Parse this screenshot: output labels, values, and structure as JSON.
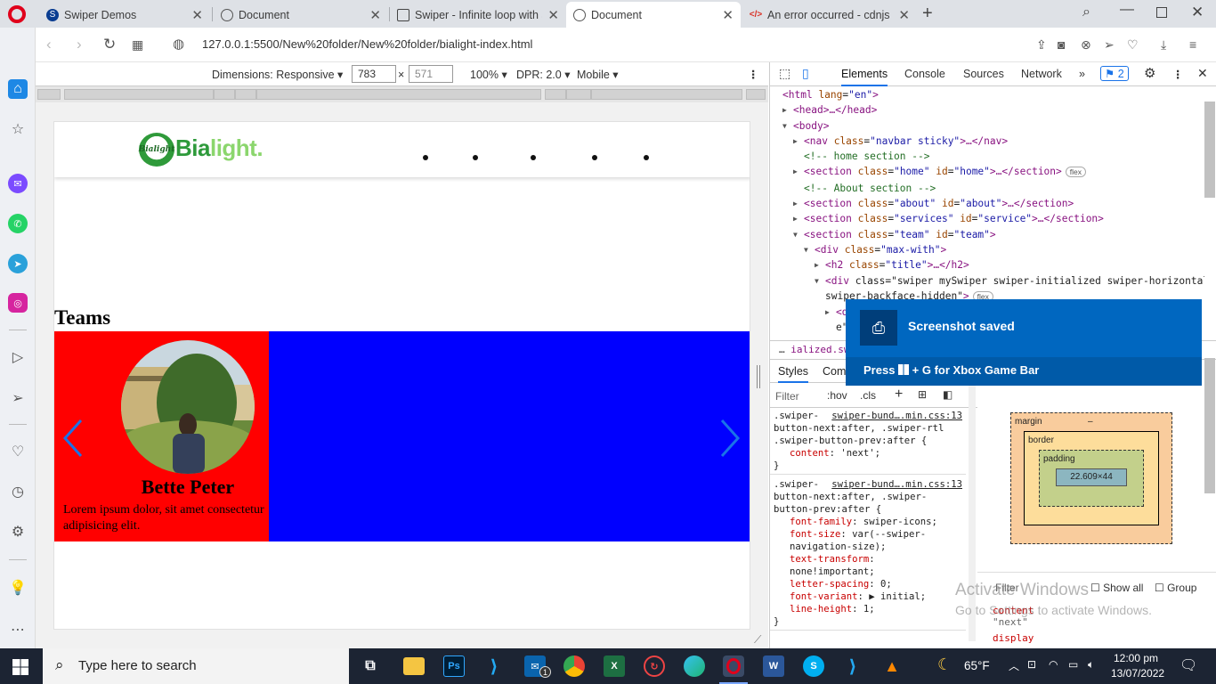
{
  "browser": {
    "tabs": [
      {
        "title": "Swiper Demos",
        "active": false
      },
      {
        "title": "Document",
        "active": false
      },
      {
        "title": "Swiper - Infinite loop with a",
        "active": false
      },
      {
        "title": "Document",
        "active": true
      },
      {
        "title": "An error occurred - cdnjs -",
        "active": false
      }
    ],
    "url": "127.0.0.1:5500/New%20folder/New%20folder/bialight-index.html"
  },
  "device_toolbar": {
    "dimensions_label": "Dimensions: Responsive",
    "width": "783",
    "x_sep": "×",
    "height": "571",
    "zoom": "100%",
    "dpr": "DPR: 2.0",
    "mode": "Mobile"
  },
  "site": {
    "logo_text": "Bialight",
    "brand_part1": "Bia",
    "brand_part2": "light.",
    "section_title": "Teams",
    "member_name": "Bette Peter",
    "member_desc": "Lorem ipsum dolor, sit amet consectetur adipisicing elit.",
    "colors": {
      "slide_active": "#ff0000",
      "swiper_bg": "#0000ff",
      "arrow": "#1a73e8"
    }
  },
  "devtools": {
    "tabs": [
      "Elements",
      "Console",
      "Sources",
      "Network"
    ],
    "issues_badge": "2",
    "dom_lines": [
      {
        "indent": 0,
        "arrow": "",
        "html": "<html lang=\"en\">"
      },
      {
        "indent": 1,
        "arrow": "▶",
        "html": "<head>…</head>"
      },
      {
        "indent": 1,
        "arrow": "▼",
        "html": "<body>"
      },
      {
        "indent": 2,
        "arrow": "▶",
        "html": "<nav class=\"navbar sticky\">…</nav>"
      },
      {
        "indent": 2,
        "arrow": "",
        "html": "<!-- home section -->"
      },
      {
        "indent": 2,
        "arrow": "▶",
        "html": "<section class=\"home\" id=\"home\">…</section>"
      },
      {
        "indent": 2,
        "arrow": "",
        "html": "<!-- About section -->"
      },
      {
        "indent": 2,
        "arrow": "▶",
        "html": "<section class=\"about\" id=\"about\">…</section>"
      },
      {
        "indent": 2,
        "arrow": "▶",
        "html": "<section class=\"services\" id=\"service\">…</section>"
      },
      {
        "indent": 2,
        "arrow": "▼",
        "html": "<section class=\"team\" id=\"team\">"
      },
      {
        "indent": 3,
        "arrow": "▼",
        "html": "<div class=\"max-with\">"
      },
      {
        "indent": 4,
        "arrow": "▶",
        "html": "<h2 class=\"title\">…</h2>"
      },
      {
        "indent": 4,
        "arrow": "▼",
        "html": "<div class=\"swiper mySwiper swiper-initialized swiper-horizontal"
      },
      {
        "indent": 4,
        "arrow": "",
        "html": "swiper-backface-hidden\">"
      },
      {
        "indent": 5,
        "arrow": "▶",
        "html": "<d"
      },
      {
        "indent": 5,
        "arrow": "",
        "html": "e\""
      }
    ],
    "flex_badge": "flex",
    "breadcrumb": "ialized.swip",
    "styles_tabs": [
      "Styles",
      "Com"
    ],
    "filter_placeholder": "Filter",
    "hov": ":hov",
    "cls": ".cls",
    "rules": [
      {
        "source": "swiper-bund….min.css:13",
        "selector": ".swiper-button-next:after, .swiper-rtl .swiper-button-prev:after {",
        "props": [
          [
            "content",
            "'next';"
          ]
        ]
      },
      {
        "source": "swiper-bund….min.css:13",
        "selector": ".swiper-button-next:after, .swiper-button-prev:after {",
        "props": [
          [
            "font-family",
            "swiper-icons;"
          ],
          [
            "font-size",
            "var(--swiper-navigation-size);"
          ],
          [
            "text-transform",
            "none!important;"
          ],
          [
            "letter-spacing",
            "0;"
          ],
          [
            "font-variant",
            "▶ initial;"
          ],
          [
            "line-height",
            "1;"
          ]
        ]
      }
    ],
    "box_model": {
      "margin": "margin",
      "border": "border",
      "padding": "padding",
      "content": "22.609×44",
      "dash": "–"
    },
    "computed": {
      "filter": "Filter",
      "show_all": "Show all",
      "group": "Group",
      "prop1": "content",
      "val1": "\"next\"",
      "prop2": "display"
    }
  },
  "toast": {
    "title": "Screenshot saved",
    "hint_pre": "Press",
    "hint_post": "+ G for Xbox Game Bar"
  },
  "watermark": {
    "line1": "Activate Windows",
    "line2": "Go to Settings to activate Windows."
  },
  "taskbar": {
    "search_placeholder": "Type here to search",
    "temperature": "65°F",
    "time": "12:00 pm",
    "date": "13/07/2022",
    "mail_badge": "1"
  }
}
